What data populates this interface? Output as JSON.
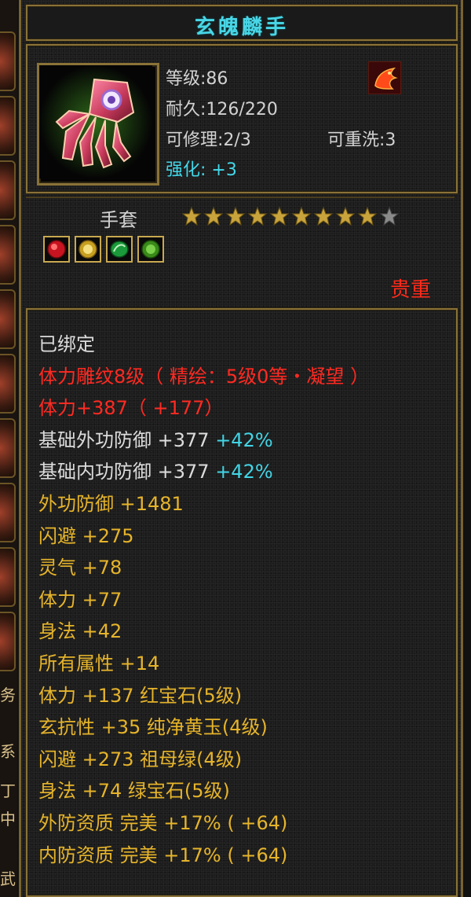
{
  "side": {
    "chars": [
      "务",
      "系",
      "丁",
      "中",
      "武"
    ]
  },
  "item": {
    "title": "玄魄麟手",
    "level_label": "等级:",
    "level": "86",
    "durability_label": "耐久:",
    "durability": "126/220",
    "repairable_label": "可修理:",
    "repairable": "2/3",
    "rewash_label": "可重洗:",
    "rewash": "3",
    "enhance_label": "强化:",
    "enhance": "+3",
    "icon": "red-gauntlet-icon",
    "badge_icon": "phoenix-emblem-icon",
    "type": "手套",
    "stars_filled": 9,
    "stars_total": 10,
    "gems": [
      "ruby-gem-icon",
      "topaz-gem-icon",
      "emerald-gem-icon",
      "green-gem-icon"
    ],
    "quality": "贵重"
  },
  "stats": [
    {
      "text": "已绑定",
      "color": "white"
    },
    {
      "text": "体力雕纹8级（ 精绘：5级0等・凝望 ）",
      "color": "red"
    },
    {
      "text": "体力+387（ +177）",
      "color": "red"
    },
    {
      "text": "基础外功防御 +377 ",
      "color": "white",
      "extra": "+42%"
    },
    {
      "text": "基础内功防御 +377 ",
      "color": "white",
      "extra": "+42%"
    },
    {
      "text": "外功防御 +1481",
      "color": "yellow"
    },
    {
      "text": "闪避 +275",
      "color": "yellow"
    },
    {
      "text": "灵气 +78",
      "color": "yellow"
    },
    {
      "text": "体力 +77",
      "color": "yellow"
    },
    {
      "text": "身法 +42",
      "color": "yellow"
    },
    {
      "text": "所有属性 +14",
      "color": "yellow"
    },
    {
      "text": "体力 +137 红宝石(5级)",
      "color": "yellow"
    },
    {
      "text": "玄抗性 +35 纯净黄玉(4级)",
      "color": "yellow"
    },
    {
      "text": "闪避 +273 祖母绿(4级)",
      "color": "yellow"
    },
    {
      "text": "身法 +74 绿宝石(5级)",
      "color": "yellow"
    },
    {
      "text": "外防资质  完美 +17% ( +64)",
      "color": "yellow"
    },
    {
      "text": "内防资质  完美 +17% ( +64)",
      "color": "yellow"
    }
  ],
  "colors": {
    "white": "#dcdcdc",
    "red": "#ff2a22",
    "yellow": "#e6b42a",
    "cyan": "#41d5e6",
    "frame": "#8a7238",
    "star_on": "#c9a43c",
    "star_off": "#8a8a8a"
  }
}
